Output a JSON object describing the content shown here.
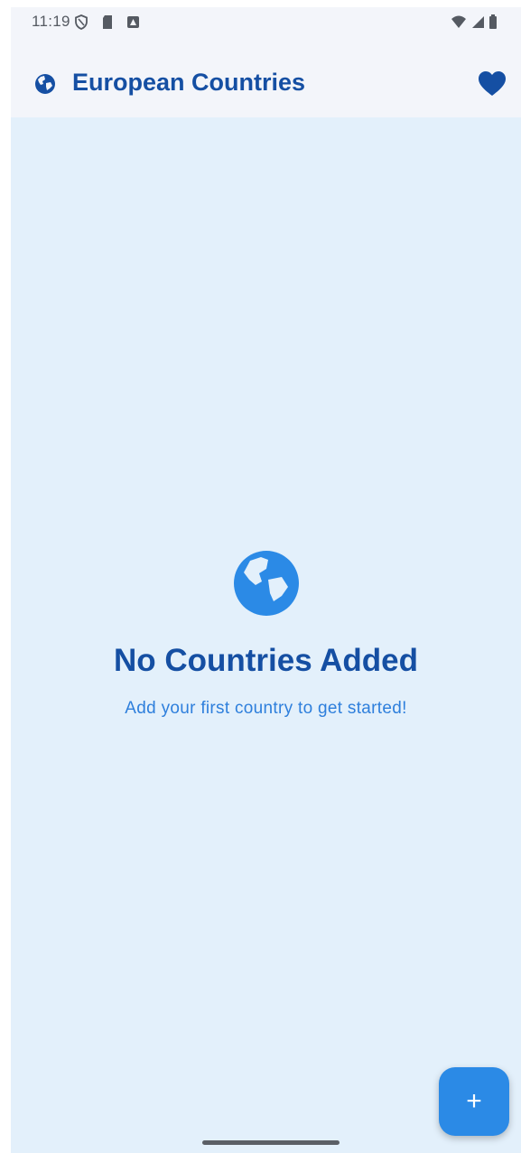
{
  "status_bar": {
    "time": "11:19",
    "left_icons": [
      "shield-icon",
      "sim-card-icon",
      "notification-icon"
    ],
    "right_icons": [
      "wifi-icon",
      "cellular-signal-icon",
      "battery-icon"
    ]
  },
  "app_bar": {
    "title": "European Countries",
    "leading_icon": "globe-icon",
    "trailing_icon": "heart-icon"
  },
  "empty_state": {
    "icon": "globe-icon",
    "title": "No Countries Added",
    "subtitle": "Add your first country to get started!"
  },
  "fab": {
    "label": "+",
    "icon": "add-icon"
  },
  "colors": {
    "primary": "#154fa3",
    "accent": "#2b8ae6",
    "background": "#e3f0fb",
    "app_bar": "#f3f5fa"
  }
}
